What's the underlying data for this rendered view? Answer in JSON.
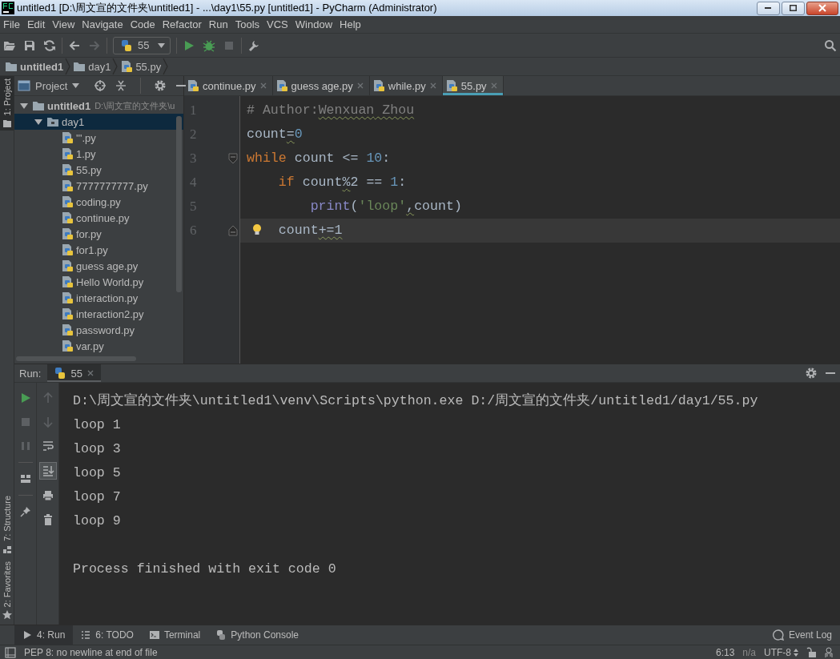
{
  "window": {
    "title": "untitled1 [D:\\周文宣的文件夹\\untitled1] - ...\\day1\\55.py [untitled1] - PyCharm (Administrator)"
  },
  "menu": [
    "File",
    "Edit",
    "View",
    "Navigate",
    "Code",
    "Refactor",
    "Run",
    "Tools",
    "VCS",
    "Window",
    "Help"
  ],
  "toolbar": {
    "groups": [
      [
        {
          "kind": "open",
          "disabled": false
        },
        {
          "kind": "save",
          "disabled": false
        },
        {
          "kind": "sync",
          "disabled": false
        }
      ],
      [
        {
          "kind": "back",
          "disabled": false
        },
        {
          "kind": "forward",
          "disabled": true
        }
      ],
      [
        {
          "kind": "config",
          "label": "55",
          "disabled": false
        }
      ],
      [
        {
          "kind": "run",
          "disabled": false
        },
        {
          "kind": "debug",
          "disabled": false
        },
        {
          "kind": "stop",
          "disabled": true
        }
      ],
      [
        {
          "kind": "wrench",
          "disabled": false
        }
      ]
    ]
  },
  "breadcrumbs": [
    {
      "label": "untitled1",
      "kind": "project"
    },
    {
      "label": "day1",
      "kind": "folder"
    },
    {
      "label": "55.py",
      "kind": "file"
    }
  ],
  "side_tabs_top": [
    {
      "label": "1: Project",
      "kind": "project",
      "selected": true
    }
  ],
  "side_tabs_bottom": [
    {
      "label": "7: Structure",
      "kind": "structure",
      "selected": false
    },
    {
      "label": "2: Favorites",
      "kind": "favorites",
      "selected": false
    }
  ],
  "project_panel": {
    "title": "Project",
    "tree": [
      {
        "label": "untitled1",
        "path": "D:\\周文宣的文件夹\\u",
        "kind": "project",
        "expanded": true,
        "selected": false,
        "children": [
          {
            "label": "day1",
            "kind": "folder",
            "expanded": true,
            "selected": true,
            "children": [
              {
                "label": "'''.py",
                "kind": "file",
                "selected": false
              },
              {
                "label": "1.py",
                "kind": "file",
                "selected": false
              },
              {
                "label": "55.py",
                "kind": "file",
                "selected": false
              },
              {
                "label": "7777777777.py",
                "kind": "file",
                "selected": false
              },
              {
                "label": "coding.py",
                "kind": "file",
                "selected": false
              },
              {
                "label": "continue.py",
                "kind": "file",
                "selected": false
              },
              {
                "label": "for.py",
                "kind": "file",
                "selected": false
              },
              {
                "label": "for1.py",
                "kind": "file",
                "selected": false
              },
              {
                "label": "guess age.py",
                "kind": "file",
                "selected": false
              },
              {
                "label": "Hello World.py",
                "kind": "file",
                "selected": false
              },
              {
                "label": "interaction.py",
                "kind": "file",
                "selected": false
              },
              {
                "label": "interaction2.py",
                "kind": "file",
                "selected": false
              },
              {
                "label": "password.py",
                "kind": "file",
                "selected": false
              },
              {
                "label": "var.py",
                "kind": "file",
                "selected": false
              }
            ]
          }
        ]
      }
    ]
  },
  "editor": {
    "tabs": [
      {
        "label": "continue.py",
        "selected": false
      },
      {
        "label": "guess age.py",
        "selected": false
      },
      {
        "label": "while.py",
        "selected": false
      },
      {
        "label": "55.py",
        "selected": true
      }
    ],
    "lines": [
      {
        "number": "1",
        "current": false,
        "fold_start": false,
        "fold_end": false,
        "intention": false,
        "tokens": [
          {
            "text": "# Author:",
            "kind": "comment",
            "warning": false
          },
          {
            "text": "Wenxuan",
            "kind": "comment",
            "warning": true
          },
          {
            "text": " Zhou",
            "kind": "comment",
            "warning": true
          }
        ]
      },
      {
        "number": "2",
        "current": false,
        "fold_start": false,
        "fold_end": false,
        "intention": false,
        "tokens": [
          {
            "text": "count",
            "kind": "plain",
            "warning": false
          },
          {
            "text": "=",
            "kind": "plain",
            "warning": true
          },
          {
            "text": "0",
            "kind": "number",
            "warning": false
          }
        ]
      },
      {
        "number": "3",
        "current": false,
        "fold_start": true,
        "fold_end": false,
        "intention": false,
        "tokens": [
          {
            "text": "while",
            "kind": "keyword",
            "warning": false
          },
          {
            "text": " count <= ",
            "kind": "plain",
            "warning": false
          },
          {
            "text": "10",
            "kind": "number",
            "warning": false
          },
          {
            "text": ":",
            "kind": "plain",
            "warning": false
          }
        ]
      },
      {
        "number": "4",
        "current": false,
        "fold_start": false,
        "fold_end": false,
        "intention": false,
        "tokens": [
          {
            "text": "    if",
            "kind": "keyword",
            "warning": false
          },
          {
            "text": " count",
            "kind": "plain",
            "warning": false
          },
          {
            "text": "%",
            "kind": "plain",
            "warning": true
          },
          {
            "text": "2 == ",
            "kind": "plain",
            "warning": false
          },
          {
            "text": "1",
            "kind": "number",
            "warning": false
          },
          {
            "text": ":",
            "kind": "plain",
            "warning": false
          }
        ]
      },
      {
        "number": "5",
        "current": false,
        "fold_start": false,
        "fold_end": false,
        "intention": false,
        "tokens": [
          {
            "text": "        print",
            "kind": "builtin",
            "warning": false
          },
          {
            "text": "(",
            "kind": "plain",
            "warning": false
          },
          {
            "text": "'loop'",
            "kind": "string",
            "warning": false
          },
          {
            "text": ",",
            "kind": "plain",
            "warning": true
          },
          {
            "text": "count)",
            "kind": "plain",
            "warning": false
          }
        ]
      },
      {
        "number": "6",
        "current": true,
        "fold_start": false,
        "fold_end": true,
        "intention": true,
        "tokens": [
          {
            "text": "    count",
            "kind": "plain",
            "warning": false
          },
          {
            "text": "+=1",
            "kind": "plain",
            "warning": true
          }
        ]
      }
    ]
  },
  "run": {
    "label": "Run:",
    "tabs": [
      {
        "label": "55",
        "selected": true
      }
    ],
    "tools_primary": [
      {
        "kind": "rerun",
        "disabled": false
      },
      {
        "kind": "stop",
        "disabled": true
      },
      {
        "kind": "pause",
        "disabled": true
      },
      {
        "kind": "layout",
        "disabled": false
      },
      {
        "kind": "pin",
        "disabled": false
      }
    ],
    "tools_secondary": [
      {
        "kind": "up",
        "disabled": true,
        "on": false
      },
      {
        "kind": "down",
        "disabled": true,
        "on": false
      },
      {
        "kind": "wrap",
        "disabled": false,
        "on": false
      },
      {
        "kind": "scroll_end",
        "disabled": false,
        "on": true
      },
      {
        "kind": "print",
        "disabled": false,
        "on": false
      },
      {
        "kind": "trash",
        "disabled": false,
        "on": false
      }
    ],
    "console": {
      "command": "D:\\周文宣的文件夹\\untitled1\\venv\\Scripts\\python.exe D:/周文宣的文件夹/untitled1/day1/55.py",
      "output": [
        "loop 1",
        "loop 3",
        "loop 5",
        "loop 7",
        "loop 9"
      ],
      "exit": "Process finished with exit code 0"
    }
  },
  "bottom_tabs": [
    {
      "label": "4: Run",
      "kind": "run",
      "selected": true
    },
    {
      "label": "6: TODO",
      "kind": "todo",
      "selected": false
    },
    {
      "label": "Terminal",
      "kind": "terminal",
      "selected": false
    },
    {
      "label": "Python Console",
      "kind": "python",
      "selected": false
    }
  ],
  "event_log": "Event Log",
  "status": {
    "message": "PEP 8: no newline at end of file",
    "position": "6:13",
    "line_separator": "n/a",
    "encoding": "UTF-8"
  }
}
